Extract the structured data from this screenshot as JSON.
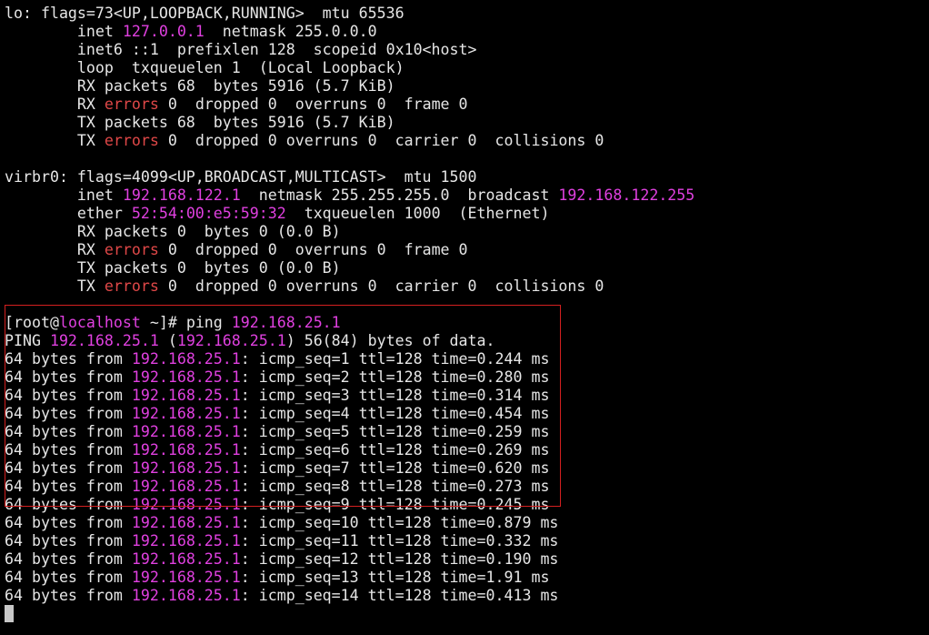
{
  "colors": {
    "background": "#000000",
    "text": "#e6e6e6",
    "address_highlight": "#e040e0",
    "error_highlight": "#e04848",
    "selection_box": "#d42020"
  },
  "lines": [
    [
      {
        "t": "lo: flags=73<UP,LOOPBACK,RUNNING>  mtu 65536"
      }
    ],
    [
      {
        "t": "        inet "
      },
      {
        "t": "127.0.0.1",
        "c": "hl"
      },
      {
        "t": "  netmask 255.0.0.0"
      }
    ],
    [
      {
        "t": "        inet6 ::1  prefixlen 128  scopeid 0x10<host>"
      }
    ],
    [
      {
        "t": "        loop  txqueuelen 1  (Local Loopback)"
      }
    ],
    [
      {
        "t": "        RX packets 68  bytes 5916 (5.7 KiB)"
      }
    ],
    [
      {
        "t": "        RX "
      },
      {
        "t": "errors",
        "c": "err"
      },
      {
        "t": " 0  dropped 0  overruns 0  frame 0"
      }
    ],
    [
      {
        "t": "        TX packets 68  bytes 5916 (5.7 KiB)"
      }
    ],
    [
      {
        "t": "        TX "
      },
      {
        "t": "errors",
        "c": "err"
      },
      {
        "t": " 0  dropped 0 overruns 0  carrier 0  collisions 0"
      }
    ],
    [
      {
        "t": ""
      }
    ],
    [
      {
        "t": "virbr0: flags=4099<UP,BROADCAST,MULTICAST>  mtu 1500"
      }
    ],
    [
      {
        "t": "        inet "
      },
      {
        "t": "192.168.122.1",
        "c": "hl"
      },
      {
        "t": "  netmask 255.255.255.0  broadcast "
      },
      {
        "t": "192.168.122.255",
        "c": "hl"
      }
    ],
    [
      {
        "t": "        ether "
      },
      {
        "t": "52:54:00:e5:59:32",
        "c": "hl"
      },
      {
        "t": "  txqueuelen 1000  (Ethernet)"
      }
    ],
    [
      {
        "t": "        RX packets 0  bytes 0 (0.0 B)"
      }
    ],
    [
      {
        "t": "        RX "
      },
      {
        "t": "errors",
        "c": "err"
      },
      {
        "t": " 0  dropped 0  overruns 0  frame 0"
      }
    ],
    [
      {
        "t": "        TX packets 0  bytes 0 (0.0 B)"
      }
    ],
    [
      {
        "t": "        TX "
      },
      {
        "t": "errors",
        "c": "err"
      },
      {
        "t": " 0  dropped 0 overruns 0  carrier 0  collisions 0"
      }
    ],
    [
      {
        "t": ""
      }
    ],
    [
      {
        "t": "[root@"
      },
      {
        "t": "localhost",
        "c": "hl"
      },
      {
        "t": " ~]# ping "
      },
      {
        "t": "192.168.25.1",
        "c": "hl"
      }
    ],
    [
      {
        "t": "PING "
      },
      {
        "t": "192.168.25.1",
        "c": "hl"
      },
      {
        "t": " ("
      },
      {
        "t": "192.168.25.1",
        "c": "hl"
      },
      {
        "t": ") 56(84) bytes of data."
      }
    ],
    [
      {
        "t": "64 bytes from "
      },
      {
        "t": "192.168.25.1",
        "c": "hl"
      },
      {
        "t": ": icmp_seq=1 ttl=128 time=0.244 ms"
      }
    ],
    [
      {
        "t": "64 bytes from "
      },
      {
        "t": "192.168.25.1",
        "c": "hl"
      },
      {
        "t": ": icmp_seq=2 ttl=128 time=0.280 ms"
      }
    ],
    [
      {
        "t": "64 bytes from "
      },
      {
        "t": "192.168.25.1",
        "c": "hl"
      },
      {
        "t": ": icmp_seq=3 ttl=128 time=0.314 ms"
      }
    ],
    [
      {
        "t": "64 bytes from "
      },
      {
        "t": "192.168.25.1",
        "c": "hl"
      },
      {
        "t": ": icmp_seq=4 ttl=128 time=0.454 ms"
      }
    ],
    [
      {
        "t": "64 bytes from "
      },
      {
        "t": "192.168.25.1",
        "c": "hl"
      },
      {
        "t": ": icmp_seq=5 ttl=128 time=0.259 ms"
      }
    ],
    [
      {
        "t": "64 bytes from "
      },
      {
        "t": "192.168.25.1",
        "c": "hl"
      },
      {
        "t": ": icmp_seq=6 ttl=128 time=0.269 ms"
      }
    ],
    [
      {
        "t": "64 bytes from "
      },
      {
        "t": "192.168.25.1",
        "c": "hl"
      },
      {
        "t": ": icmp_seq=7 ttl=128 time=0.620 ms"
      }
    ],
    [
      {
        "t": "64 bytes from "
      },
      {
        "t": "192.168.25.1",
        "c": "hl"
      },
      {
        "t": ": icmp_seq=8 ttl=128 time=0.273 ms"
      }
    ],
    [
      {
        "t": "64 bytes from "
      },
      {
        "t": "192.168.25.1",
        "c": "hl"
      },
      {
        "t": ": icmp_seq=9 ttl=128 time=0.245 ms"
      }
    ],
    [
      {
        "t": "64 bytes from "
      },
      {
        "t": "192.168.25.1",
        "c": "hl"
      },
      {
        "t": ": icmp_seq=10 ttl=128 time=0.879 ms"
      }
    ],
    [
      {
        "t": "64 bytes from "
      },
      {
        "t": "192.168.25.1",
        "c": "hl"
      },
      {
        "t": ": icmp_seq=11 ttl=128 time=0.332 ms"
      }
    ],
    [
      {
        "t": "64 bytes from "
      },
      {
        "t": "192.168.25.1",
        "c": "hl"
      },
      {
        "t": ": icmp_seq=12 ttl=128 time=0.190 ms"
      }
    ],
    [
      {
        "t": "64 bytes from "
      },
      {
        "t": "192.168.25.1",
        "c": "hl"
      },
      {
        "t": ": icmp_seq=13 ttl=128 time=1.91 ms"
      }
    ],
    [
      {
        "t": "64 bytes from "
      },
      {
        "t": "192.168.25.1",
        "c": "hl"
      },
      {
        "t": ": icmp_seq=14 ttl=128 time=0.413 ms"
      }
    ]
  ]
}
